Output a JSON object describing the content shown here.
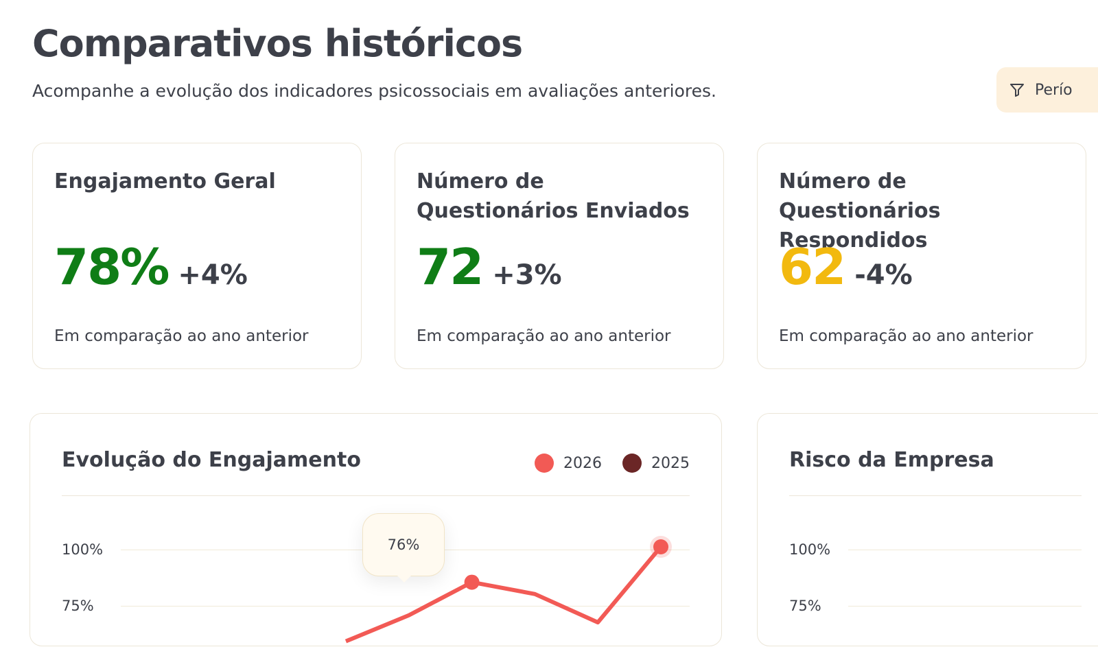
{
  "header": {
    "title": "Comparativos históricos",
    "subtitle": "Acompanhe a evolução dos indicadores psicossociais em avaliações anteriores.",
    "filter_label": "Perío",
    "filter_icon": "filter-icon"
  },
  "kpis": [
    {
      "title": "Engajamento Geral",
      "value": "78%",
      "delta": "+4%",
      "caption": "Em comparação ao ano anterior",
      "value_color": "#0f7d16"
    },
    {
      "title": "Número de Questionários Enviados",
      "value": "72",
      "delta": "+3%",
      "caption": "Em comparação ao ano anterior",
      "value_color": "#0f7d16"
    },
    {
      "title": "Número de Questionários Respondidos",
      "value": "62",
      "delta": "-4%",
      "caption": "Em comparação ao ano anterior",
      "value_color": "#f2b90f"
    }
  ],
  "charts": {
    "engagement": {
      "title": "Evolução do Engajamento",
      "legend": [
        {
          "label": "2026",
          "color": "#f25a55"
        },
        {
          "label": "2025",
          "color": "#6b2626"
        }
      ],
      "y_ticks": [
        "100%",
        "75%"
      ],
      "tooltip": "76%"
    },
    "risk": {
      "title": "Risco da Empresa",
      "y_ticks": [
        "100%",
        "75%"
      ]
    }
  },
  "chart_data": [
    {
      "type": "line",
      "title": "Evolução do Engajamento",
      "series": [
        {
          "name": "2026",
          "x": [
            0,
            1,
            2,
            3,
            4,
            5
          ],
          "values": [
            60,
            71,
            85,
            80,
            68,
            100
          ],
          "color": "#f25a55"
        }
      ],
      "ylim": [
        0,
        100
      ],
      "y_ticks": [
        "100%",
        "75%"
      ],
      "legend": "top-right",
      "annotation": "76%"
    },
    {
      "type": "line",
      "title": "Risco da Empresa",
      "series": [],
      "ylim": [
        0,
        100
      ],
      "y_ticks": [
        "100%",
        "75%"
      ]
    }
  ],
  "colors": {
    "accent": "#f25a55",
    "positive": "#0f7d16",
    "warning": "#f2b90f",
    "border": "#ece6d8",
    "filter_bg": "#fdf0dc"
  }
}
